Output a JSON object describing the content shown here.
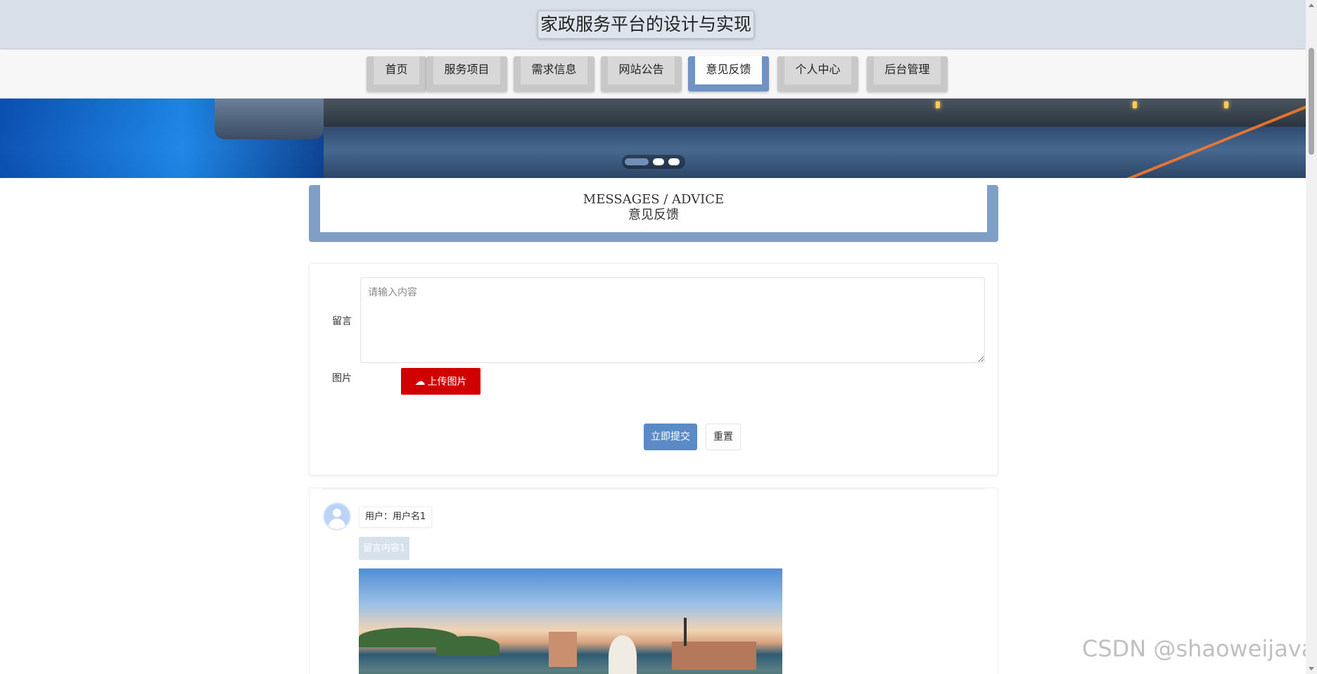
{
  "header": {
    "title": "家政服务平台的设计与实现"
  },
  "nav": {
    "items": [
      {
        "label": "首页",
        "active": false
      },
      {
        "label": "服务项目",
        "active": false
      },
      {
        "label": "需求信息",
        "active": false
      },
      {
        "label": "网站公告",
        "active": false
      },
      {
        "label": "意见反馈",
        "active": true
      },
      {
        "label": "个人中心",
        "active": false
      },
      {
        "label": "后台管理",
        "active": false
      }
    ]
  },
  "banner": {
    "slide_count": 3,
    "active_slide": 1
  },
  "section": {
    "title_en": "MESSAGES / ADVICE",
    "title_cn": "意见反馈"
  },
  "form": {
    "message_label": "留言",
    "message_placeholder": "请输入内容",
    "image_label": "图片",
    "upload_label": "上传图片",
    "submit_label": "立即提交",
    "reset_label": "重置"
  },
  "messages": [
    {
      "user": "用户：用户名1",
      "content": "留言内容1"
    }
  ],
  "watermark": "CSDN @shaoweijava",
  "colors": {
    "accent": "#7f9fc7",
    "primary_button": "#5b8bc7",
    "danger_button": "#d00000",
    "header_bg": "#d8dfe8",
    "nav_active": "#6f93c2"
  }
}
